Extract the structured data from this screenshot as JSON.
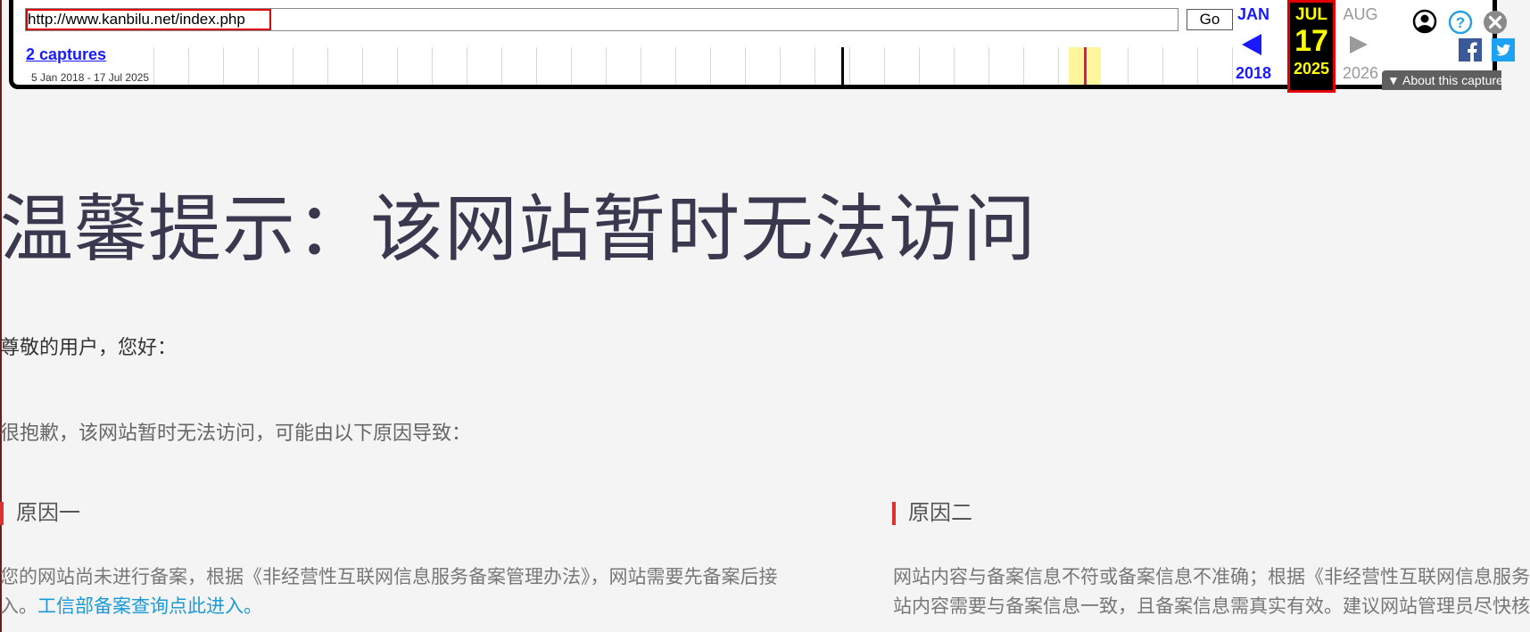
{
  "toolbar": {
    "url_value": "http://www.kanbilu.net/index.php",
    "go_label": "Go",
    "captures_label": "2 captures",
    "date_range": "5 Jan 2018 - 17 Jul 2025",
    "prev": {
      "month": "JAN",
      "year": "2018"
    },
    "current": {
      "month": "JUL",
      "day": "17",
      "year": "2025"
    },
    "next": {
      "month": "AUG",
      "year": "2026"
    },
    "about_label": "About this capture",
    "icons": [
      "user-icon",
      "help-icon",
      "close-icon",
      "facebook-icon",
      "twitter-icon"
    ],
    "colors": {
      "accent": "#1a1aff",
      "current_bg": "#000000",
      "current_text": "#ffff00",
      "highlight": "#e00000"
    }
  },
  "page": {
    "title": "温馨提示：该网站暂时无法访问",
    "greeting": "尊敬的用户，您好：",
    "intro": "很抱歉，该网站暂时无法访问，可能由以下原因导致：",
    "reasons": [
      {
        "heading": "原因一",
        "line1": "您的网站尚未进行备案，根据《非经营性互联网信息服务备案管理办法》，网站需要先备案后接",
        "line2_prefix": "入。",
        "link": "工信部备案查询点此进入。"
      },
      {
        "heading": "原因二",
        "line1": "网站内容与备案信息不符或备案信息不准确；根据《非经营性互联网信息服务备案管理办法》，网",
        "line2": "站内容需要与备案信息一致，且备案信息需真实有效。建议网站管理员尽快核实备案信息"
      }
    ]
  }
}
